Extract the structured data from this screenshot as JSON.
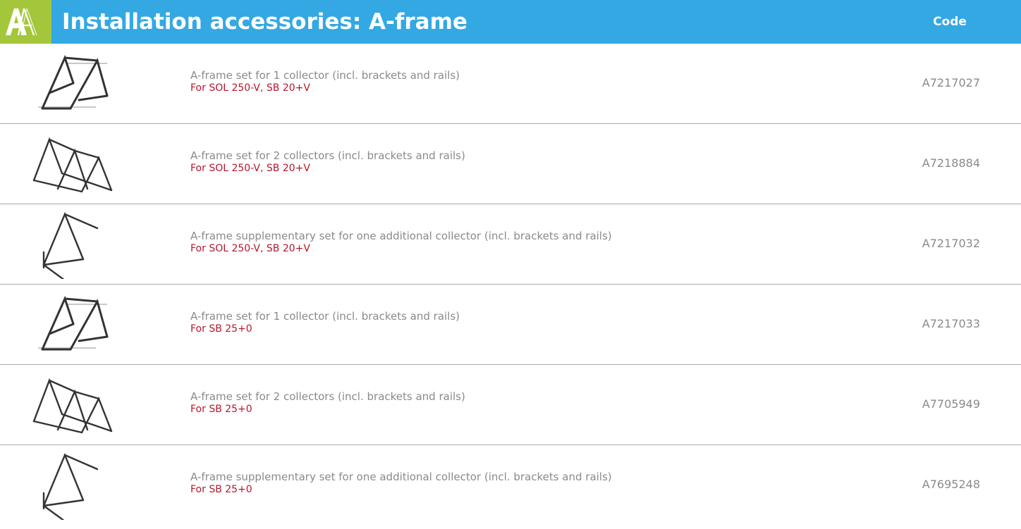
{
  "header": {
    "logo_text": "AA",
    "title": "Installation accessories: A-frame",
    "code_label": "Code"
  },
  "colors": {
    "header_bg": "#33a8e3",
    "logo_bg": "#a4c63a",
    "subtitle": "#b5172b",
    "text_gray": "#8a8a8a"
  },
  "rows": [
    {
      "image": "a-frame-1-collector",
      "description": "A-frame set for 1 collector (incl. brackets and rails)",
      "for": "For SOL 250-V, SB 20+V",
      "code": "A7217027"
    },
    {
      "image": "a-frame-2-collectors",
      "description": "A-frame set for 2 collectors (incl. brackets and rails)",
      "for": "For SOL 250-V, SB 20+V",
      "code": "A7218884"
    },
    {
      "image": "a-frame-supplementary",
      "description": "A-frame supplementary set for one additional collector (incl. brackets and rails)",
      "for": "For SOL 250-V, SB 20+V",
      "code": "A7217032"
    },
    {
      "image": "a-frame-1-collector",
      "description": "A-frame set for 1 collector (incl. brackets and rails)",
      "for": "For SB 25+0",
      "code": "A7217033"
    },
    {
      "image": "a-frame-2-collectors",
      "description": "A-frame set for 2 collectors (incl. brackets and rails)",
      "for": "For SB 25+0",
      "code": "A7705949"
    },
    {
      "image": "a-frame-supplementary",
      "description": "A-frame supplementary set for one additional collector (incl. brackets and rails)",
      "for": "For SB 25+0",
      "code": "A7695248"
    }
  ]
}
